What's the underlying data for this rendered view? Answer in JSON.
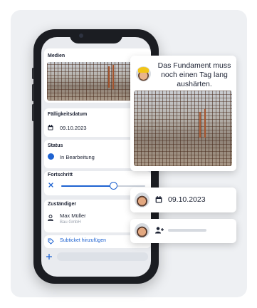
{
  "sections": {
    "media": {
      "label": "Medien"
    },
    "due_date": {
      "label": "Fälligkeitsdatum",
      "value": "09.10.2023"
    },
    "status": {
      "label": "Status",
      "value": "In Bearbeitung",
      "color": "#1f63d1"
    },
    "progress": {
      "label": "Fortschritt",
      "value_fraction": 0.62
    },
    "assignee": {
      "label": "Zuständiger",
      "name": "Max Müller",
      "company": "Bau GmbH"
    },
    "subticket": {
      "label": "Subticket hinzufügen"
    }
  },
  "comment_card": {
    "message": "Das Fundament muss noch einen Tag lang aushärten."
  },
  "date_card": {
    "value": "09.10.2023"
  },
  "colors": {
    "accent": "#1f63d1",
    "background": "#eef0f3",
    "phone_frame": "#1b1d22"
  }
}
